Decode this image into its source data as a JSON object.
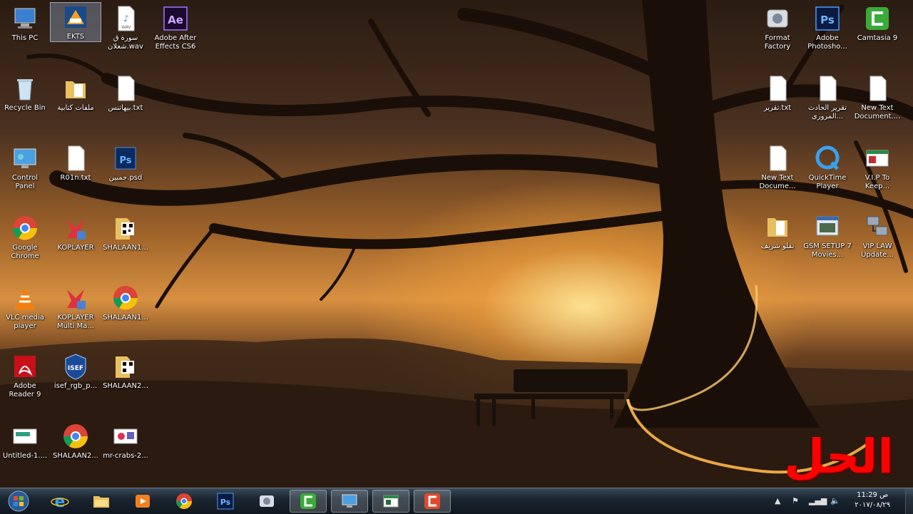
{
  "desktop_icons": [
    {
      "label": "This PC",
      "icon": "this-pc-icon"
    },
    {
      "label": "EKTS",
      "icon": "ekts-icon",
      "selected": true
    },
    {
      "label": "سورة ق\nشعلان.wav",
      "icon": "wav-file-icon"
    },
    {
      "label": "Adobe After\nEffects CS6",
      "icon": "after-effects-icon"
    },
    {
      "label": "Recycle Bin",
      "icon": "recycle-bin-icon"
    },
    {
      "label": "ملفات كتابية",
      "icon": "folder-icon"
    },
    {
      "label": "بيهاتنس.txt",
      "icon": "text-file-icon"
    },
    {
      "label": "Control\nPanel",
      "icon": "control-panel-icon"
    },
    {
      "label": "R01n.txt",
      "icon": "text-file-icon"
    },
    {
      "label": "جمبين.psd",
      "icon": "psd-file-icon"
    },
    {
      "label": "Google\nChrome",
      "icon": "chrome-icon"
    },
    {
      "label": "KOPLAYER",
      "icon": "koplayer-icon"
    },
    {
      "label": "SHALAAN1...",
      "icon": "qr-folder-icon"
    },
    {
      "label": "VLC media\nplayer",
      "icon": "vlc-icon"
    },
    {
      "label": "KOPLAYER\nMulti Ma...",
      "icon": "koplayer-icon"
    },
    {
      "label": "SHALAAN1...",
      "icon": "chrome-icon"
    },
    {
      "label": "Adobe\nReader 9",
      "icon": "adobe-reader-icon"
    },
    {
      "label": "isef_rgb_p...",
      "icon": "isef-icon"
    },
    {
      "label": "SHALAAN2...",
      "icon": "qr-folder-icon"
    },
    {
      "label": "Untitled-1....",
      "icon": "image-file-icon"
    },
    {
      "label": "SHALAAN2...",
      "icon": "chrome-icon"
    },
    {
      "label": "mr-crabs-2...",
      "icon": "image-file-icon"
    },
    {
      "label": "Format\nFactory",
      "icon": "format-factory-icon"
    },
    {
      "label": "Adobe\nPhotosho...",
      "icon": "photoshop-icon"
    },
    {
      "label": "Camtasia 9",
      "icon": "camtasia-icon"
    },
    {
      "label": "تقرير.txt",
      "icon": "text-file-icon"
    },
    {
      "label": "تقرير الحادث\nالمرورى...",
      "icon": "text-file-icon"
    },
    {
      "label": "New Text\nDocument....",
      "icon": "text-file-icon"
    },
    {
      "label": "New Text\nDocume...",
      "icon": "text-file-icon"
    },
    {
      "label": "QuickTime\nPlayer",
      "icon": "quicktime-icon"
    },
    {
      "label": "V.I.P To\nKeep...",
      "icon": "app-window-icon"
    },
    {
      "label": "نقلو شريف",
      "icon": "folder-icon"
    },
    {
      "label": "GSM SETUP 7\nMovies...",
      "icon": "app-window-icon"
    },
    {
      "label": "VIP LAW\nUpdate...",
      "icon": "network-icon"
    }
  ],
  "taskbar": {
    "apps": [
      {
        "name": "internet-explorer-icon"
      },
      {
        "name": "file-explorer-icon"
      },
      {
        "name": "media-player-icon"
      },
      {
        "name": "chrome-icon"
      },
      {
        "name": "photoshop-icon"
      },
      {
        "name": "format-factory-icon"
      },
      {
        "name": "camtasia-recorder-icon",
        "active": true
      },
      {
        "name": "remote-desktop-icon",
        "active": true
      },
      {
        "name": "app-window-icon",
        "active": true
      },
      {
        "name": "camtasia-editor-icon",
        "active": true
      }
    ]
  },
  "clock": {
    "time": "11:29 ص",
    "date": "٢٠١٧/٠٨/٢٩"
  },
  "overlay_caption": "الحل",
  "colors": {
    "caption": "#ff0000",
    "taskbar": "#101820"
  }
}
